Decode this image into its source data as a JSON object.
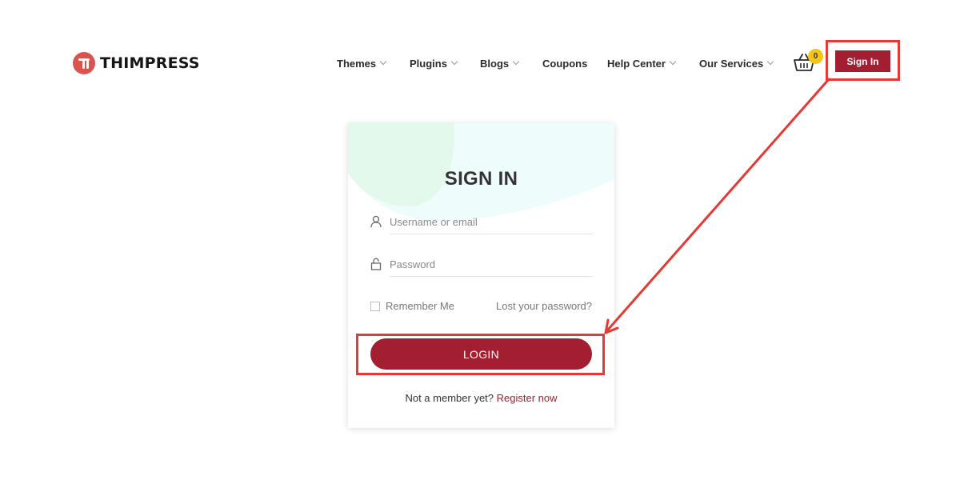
{
  "header": {
    "brand": "THIMPRESS",
    "nav": [
      {
        "label": "Themes",
        "dropdown": true
      },
      {
        "label": "Plugins",
        "dropdown": true
      },
      {
        "label": "Blogs",
        "dropdown": true
      },
      {
        "label": "Coupons",
        "dropdown": false
      },
      {
        "label": "Help Center",
        "dropdown": true
      },
      {
        "label": "Our Services",
        "dropdown": true
      }
    ],
    "cart_count": "0",
    "signin_label": "Sign In"
  },
  "login": {
    "title": "SIGN IN",
    "username_placeholder": "Username or email",
    "password_placeholder": "Password",
    "remember_label": "Remember Me",
    "lost_password": "Lost your password?",
    "login_button": "LOGIN",
    "register_prompt": "Not a member yet?",
    "register_link": "Register now"
  },
  "colors": {
    "brand": "#a21e30",
    "logo": "#d9534f",
    "badge": "#f5c518",
    "highlight": "#e53935"
  },
  "icons": [
    "logo-icon",
    "chevron-down-icon",
    "cart-icon",
    "user-icon",
    "lock-icon",
    "checkbox-icon",
    "arrow-annotation"
  ]
}
